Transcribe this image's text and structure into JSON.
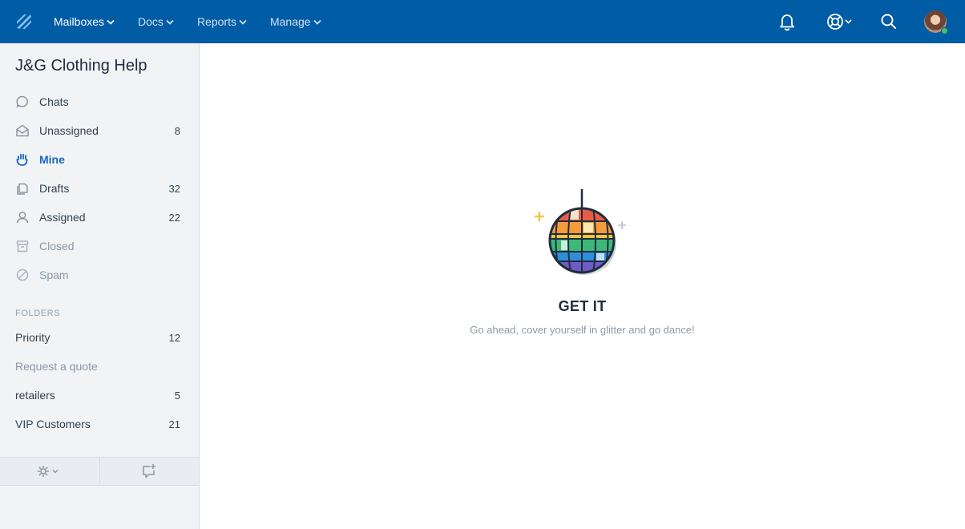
{
  "topbar": {
    "nav": [
      {
        "label": "Mailboxes",
        "active": true
      },
      {
        "label": "Docs",
        "active": false
      },
      {
        "label": "Reports",
        "active": false
      },
      {
        "label": "Manage",
        "active": false
      }
    ],
    "icons": [
      "bell-icon",
      "lifebuoy-icon",
      "search-icon"
    ],
    "status": "online"
  },
  "sidebar": {
    "mailbox_title": "J&G Clothing Help",
    "items": [
      {
        "label": "Chats",
        "count": "",
        "icon": "chat-bubble-icon"
      },
      {
        "label": "Unassigned",
        "count": "8",
        "icon": "envelope-open-icon"
      },
      {
        "label": "Mine",
        "count": "",
        "icon": "hand-icon",
        "active": true
      },
      {
        "label": "Drafts",
        "count": "32",
        "icon": "drafts-icon"
      },
      {
        "label": "Assigned",
        "count": "22",
        "icon": "person-icon"
      },
      {
        "label": "Closed",
        "count": "",
        "icon": "archive-icon"
      },
      {
        "label": "Spam",
        "count": "",
        "icon": "block-icon"
      }
    ],
    "folders_heading": "FOLDERS",
    "folders": [
      {
        "label": "Priority",
        "count": "12"
      },
      {
        "label": "Request a quote",
        "count": ""
      },
      {
        "label": "retailers",
        "count": "5"
      },
      {
        "label": "VIP Customers",
        "count": "21"
      }
    ],
    "footer_icons": [
      "gear-icon",
      "new-conversation-icon"
    ]
  },
  "empty_state": {
    "title": "GET IT",
    "subtitle": "Go ahead, cover yourself in glitter and go dance!",
    "illustration": "disco-ball-icon"
  },
  "colors": {
    "topbar": "#005ca4",
    "active": "#1768c8",
    "sidebar_bg": "#f1f3f5"
  }
}
